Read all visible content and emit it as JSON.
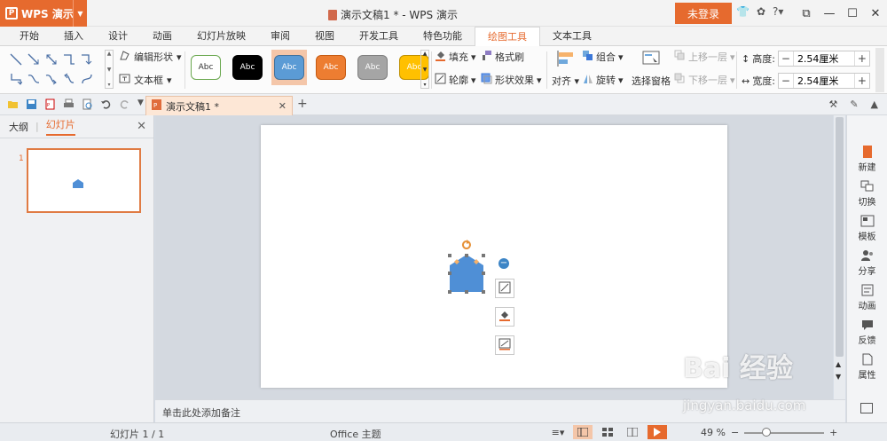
{
  "app": {
    "menu_label": "WPS 演示",
    "doc_title": "演示文稿1 * - WPS 演示",
    "login_label": "未登录",
    "help_label": "?"
  },
  "tabs": [
    {
      "label": "开始"
    },
    {
      "label": "插入"
    },
    {
      "label": "设计"
    },
    {
      "label": "动画"
    },
    {
      "label": "幻灯片放映"
    },
    {
      "label": "审阅"
    },
    {
      "label": "视图"
    },
    {
      "label": "开发工具"
    },
    {
      "label": "特色功能"
    },
    {
      "label": "绘图工具"
    },
    {
      "label": "文本工具"
    }
  ],
  "ribbon": {
    "edit_shape": "编辑形状",
    "text_box": "文本框",
    "styles": [
      {
        "label": "Abc",
        "bg": "#ffffff",
        "fg": "#333333",
        "border": "#6aa84f"
      },
      {
        "label": "Abc",
        "bg": "#000000",
        "fg": "#ffffff",
        "border": "#000000"
      },
      {
        "label": "Abc",
        "bg": "#5b9bd5",
        "fg": "#ffffff",
        "border": "#41719c"
      },
      {
        "label": "Abc",
        "bg": "#ed7d31",
        "fg": "#ffffff",
        "border": "#c55a11"
      },
      {
        "label": "Abc",
        "bg": "#a5a5a5",
        "fg": "#ffffff",
        "border": "#7f7f7f"
      },
      {
        "label": "Abc",
        "bg": "#ffc000",
        "fg": "#ffffff",
        "border": "#bf9000"
      }
    ],
    "fill": "填充",
    "format_painter": "格式刷",
    "outline": "轮廓",
    "shape_effects": "形状效果",
    "align": "对齐",
    "group": "组合",
    "rotate": "旋转",
    "selection_pane": "选择窗格",
    "bring_forward": "上移一层",
    "send_backward": "下移一层",
    "height_label": "高度:",
    "height_value": "2.54厘米",
    "width_label": "宽度:",
    "width_value": "2.54厘米"
  },
  "doc_tab": {
    "label": "演示文稿1 *"
  },
  "left_panel": {
    "tab_outline": "大纲",
    "tab_slides": "幻灯片",
    "slide_number": "1"
  },
  "notes_placeholder": "单击此处添加备注",
  "task_panel": [
    {
      "label": "新建"
    },
    {
      "label": "切换"
    },
    {
      "label": "模板"
    },
    {
      "label": "分享"
    },
    {
      "label": "动画"
    },
    {
      "label": "反馈"
    },
    {
      "label": "属性"
    }
  ],
  "status": {
    "slide_info": "幻灯片 1 / 1",
    "theme": "Office 主题",
    "zoom": "49 %"
  },
  "watermark": {
    "brand": "Bai 经验",
    "url": "jingyan.baidu.com"
  },
  "colors": {
    "accent": "#e66a2e",
    "shape_fill": "#4f8fd6"
  }
}
